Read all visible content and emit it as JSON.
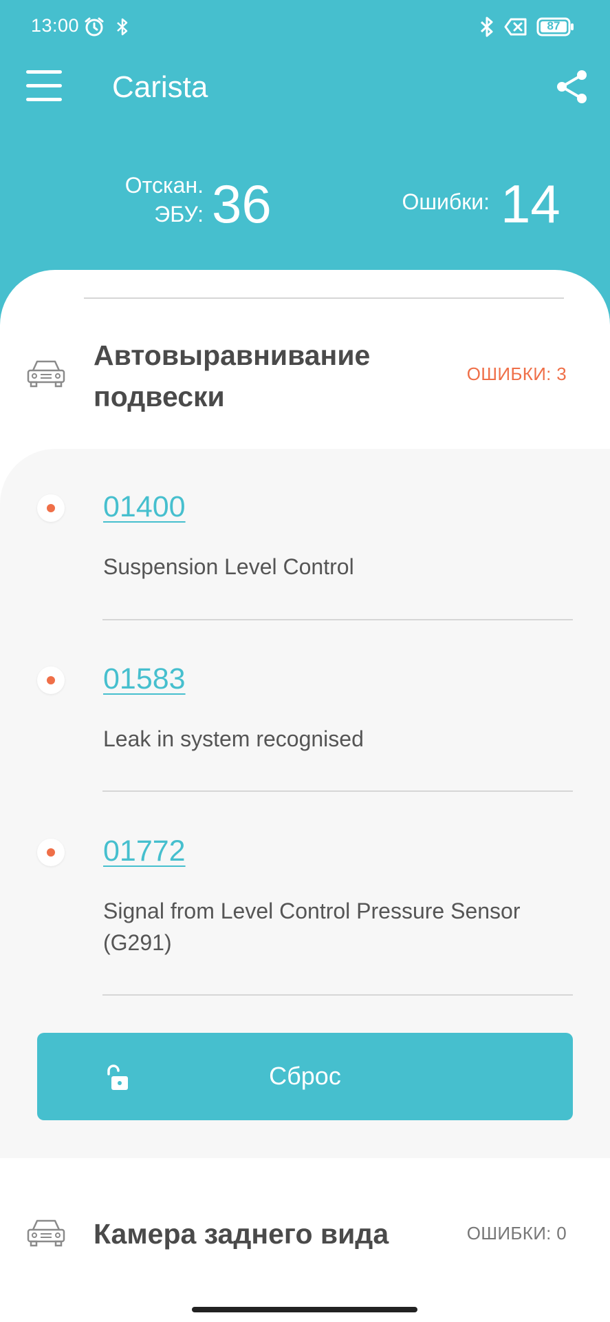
{
  "status_bar": {
    "time": "13:00",
    "battery": "87",
    "icons": [
      "alarm-icon",
      "bluetooth-icon",
      "bluetooth-icon",
      "sim-off-icon",
      "battery-icon"
    ]
  },
  "app_bar": {
    "title": "Carista",
    "menu_icon": "hamburger-menu-icon",
    "share_icon": "share-icon"
  },
  "stats": {
    "scanned_label_line1": "Отскан.",
    "scanned_label_line2": "ЭБУ:",
    "scanned_value": "36",
    "errors_label": "Ошибки:",
    "errors_value": "14"
  },
  "sections": [
    {
      "title_line1": "Автовыравнивание",
      "title_line2": "подвески",
      "errors": "ОШИБКИ: 3",
      "icon": "car-icon",
      "codes": [
        {
          "code": "01400",
          "description": "Suspension Level Control"
        },
        {
          "code": "01583",
          "description": "Leak in system recognised"
        },
        {
          "code": "01772",
          "description": "Signal from Level Control Pressure Sensor (G291)"
        }
      ],
      "reset_label": "Сброс",
      "reset_icon": "unlock-icon"
    },
    {
      "title": "Камера заднего вида",
      "errors": "ОШИБКИ: 0",
      "icon": "car-icon"
    }
  ],
  "colors": {
    "accent": "#46bfce",
    "error": "#ef6f48",
    "muted": "#777777"
  }
}
